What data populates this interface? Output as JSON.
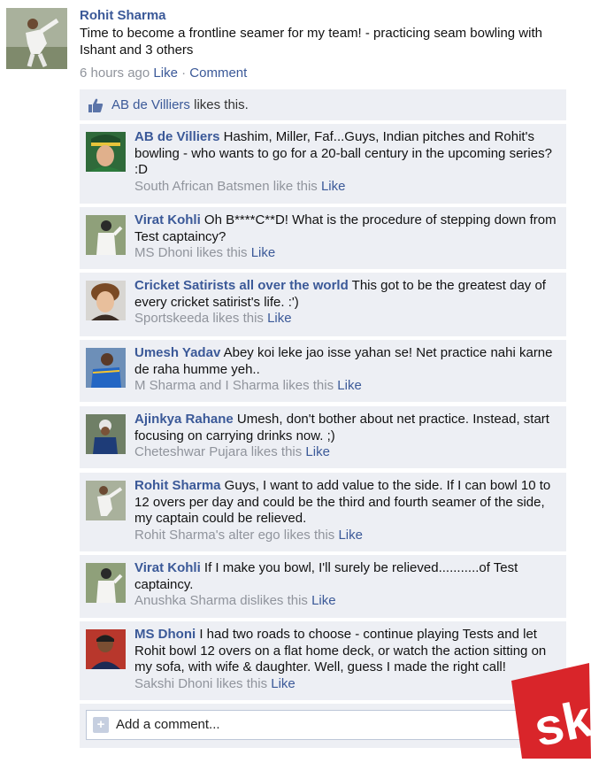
{
  "post": {
    "author": "Rohit Sharma",
    "text": "Time to become a frontline seamer for my team! - practicing seam bowling with Ishant and 3 others",
    "time": "6 hours ago",
    "like_label": "Like",
    "separator": "·",
    "comment_label": "Comment"
  },
  "likes_bar": {
    "name": "AB de Villiers",
    "suffix": " likes this."
  },
  "comments": [
    {
      "author": "AB de Villiers",
      "text": " Hashim, Miller, Faf...Guys, Indian pitches and Rohit's bowling - who wants to go for a 20-ball century in the upcoming series? :D",
      "likes": "South African Batsmen like this ",
      "like_label": "Like"
    },
    {
      "author": "Virat Kohli",
      "text": " Oh B****C**D! What is the procedure of stepping down from Test captaincy?",
      "likes": "MS Dhoni likes this ",
      "like_label": "Like"
    },
    {
      "author": "Cricket Satirists all over the world",
      "text": " This got to be the greatest day of every cricket satirist's life. :')",
      "likes": "Sportskeeda likes this ",
      "like_label": "Like"
    },
    {
      "author": "Umesh Yadav",
      "text": " Abey koi leke jao isse yahan se! Net practice nahi karne de raha humme yeh..",
      "likes": "M Sharma and I Sharma likes this ",
      "like_label": "Like"
    },
    {
      "author": "Ajinkya Rahane",
      "text": " Umesh, don't bother about net practice. Instead, start focusing on carrying drinks now. ;)",
      "likes": "Cheteshwar Pujara likes this ",
      "like_label": "Like"
    },
    {
      "author": "Rohit Sharma",
      "text": " Guys, I want to add value to the side. If I can bowl 10 to 12 overs per day and could be the third and fourth seamer of the side, my captain could be relieved.",
      "likes": "Rohit Sharma's alter ego likes this ",
      "like_label": "Like"
    },
    {
      "author": "Virat Kohli",
      "text": " If I make you bowl, I'll surely be relieved...........of Test captaincy.",
      "likes": "Anushka Sharma dislikes this ",
      "like_label": "Like"
    },
    {
      "author": "MS Dhoni",
      "text": " I had two roads to choose - continue playing Tests and let Rohit bowl 12 overs on a flat home deck, or watch the action sitting on my sofa, with wife & daughter. Well, guess I made the right call!",
      "likes": "Sakshi Dhoni likes this ",
      "like_label": "Like"
    }
  ],
  "add_comment": {
    "plus": "+",
    "placeholder": "Add a comment..."
  },
  "watermark": {
    "text": "sk",
    "color": "#d9252a"
  },
  "colors": {
    "link": "#3b5998",
    "panel": "#edeff4",
    "meta": "#90949c"
  }
}
